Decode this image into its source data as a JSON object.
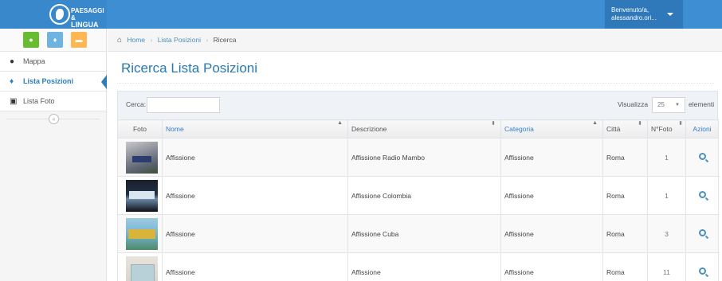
{
  "brand": {
    "line1": "PAESAGGI &",
    "line2": "LINGUA"
  },
  "user": {
    "greeting": "Benvenuto/a,",
    "name": "alessandro.ori..."
  },
  "colors": {
    "navbar": "#3d8ed3",
    "accent": "#2679b5",
    "green": "#68bc31",
    "sky": "#6fb3e0",
    "orange": "#ffb752"
  },
  "shortcuts": [
    {
      "icon": "globe-icon"
    },
    {
      "icon": "map-marker-icon"
    },
    {
      "icon": "picture-icon"
    }
  ],
  "sidebar": {
    "items": [
      {
        "label": "Mappa",
        "icon": "globe-icon"
      },
      {
        "label": "Lista Posizioni",
        "icon": "map-marker-icon",
        "active": true
      },
      {
        "label": "Lista Foto",
        "icon": "picture-icon"
      }
    ],
    "collapse_glyph": "«"
  },
  "breadcrumb": {
    "home": "Home",
    "sep1": "›",
    "item1": "Lista Posizioni",
    "sep2": "›",
    "current": "Ricerca"
  },
  "page": {
    "title": "Ricerca Lista Posizioni"
  },
  "search": {
    "label": "Cerca:",
    "value": "",
    "placeholder": ""
  },
  "length": {
    "label": "Visualizza",
    "value": "25",
    "arrow": "▼",
    "suffix": "elementi"
  },
  "table": {
    "columns": [
      "Foto",
      "Nome",
      "Descrizione",
      "Categoria",
      "Città",
      "N°Foto",
      "Azioni"
    ],
    "sort_up": "▲",
    "sort_both": "⬍",
    "rows": [
      {
        "nome": "Affissione",
        "descrizione": "Affissione Radio Mambo",
        "categoria": "Affissione",
        "citta": "Roma",
        "nfoto": "1"
      },
      {
        "nome": "Affissione",
        "descrizione": "Affissione Colombia",
        "categoria": "Affissione",
        "citta": "Roma",
        "nfoto": "1"
      },
      {
        "nome": "Affissione",
        "descrizione": "Affissione Cuba",
        "categoria": "Affissione",
        "citta": "Roma",
        "nfoto": "3"
      },
      {
        "nome": "Affissione",
        "descrizione": "Affissione",
        "categoria": "Affissione",
        "citta": "Roma",
        "nfoto": "11"
      }
    ]
  }
}
